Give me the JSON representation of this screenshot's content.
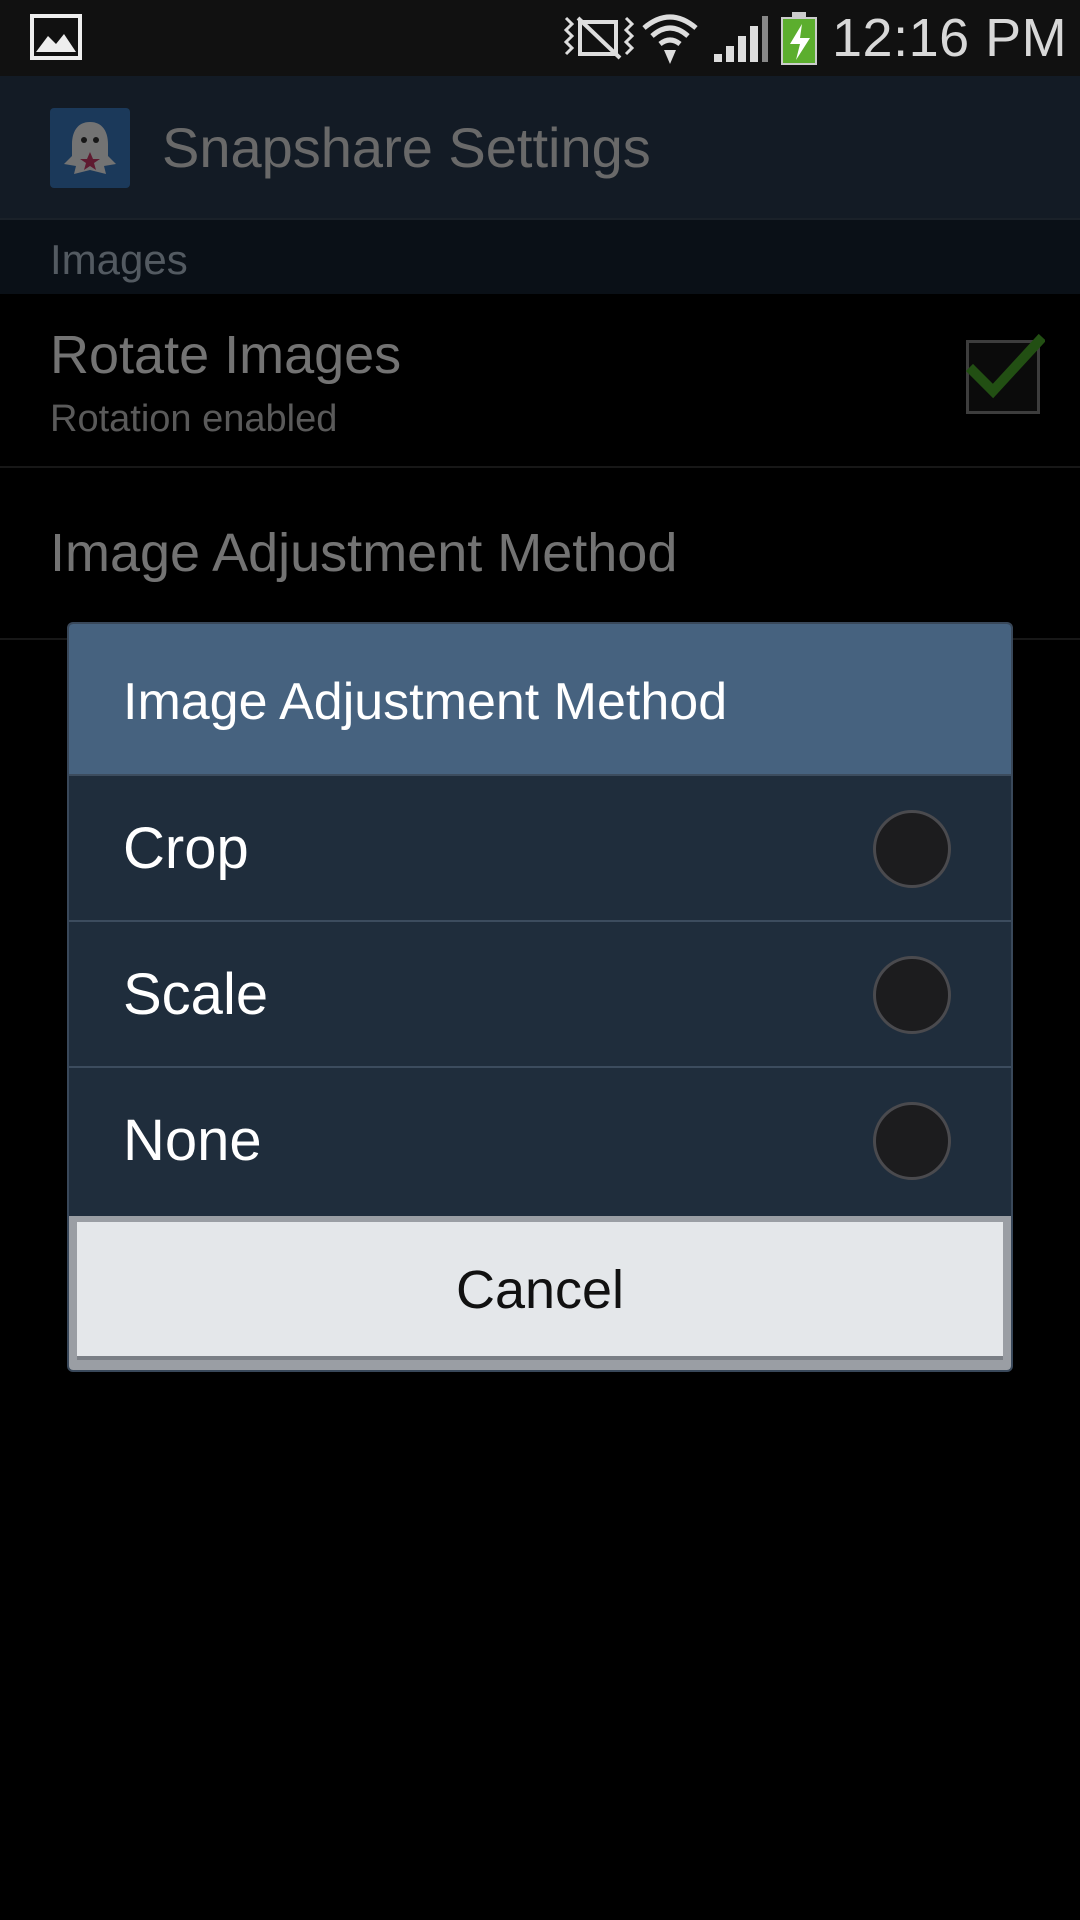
{
  "status_bar": {
    "time": "12:16 PM",
    "icons": [
      "gallery-icon",
      "nfc-icon",
      "wifi-icon",
      "signal-icon",
      "battery-charging-icon"
    ]
  },
  "action_bar": {
    "title": "Snapshare Settings",
    "app_icon": "snapshare-ghost-icon"
  },
  "section": {
    "header": "Images"
  },
  "preferences": {
    "rotate": {
      "title": "Rotate Images",
      "summary": "Rotation enabled",
      "checked": true
    },
    "adjustment": {
      "title": "Image Adjustment Method"
    }
  },
  "dialog": {
    "title": "Image Adjustment Method",
    "options": [
      {
        "label": "Crop",
        "selected": false
      },
      {
        "label": "Scale",
        "selected": false
      },
      {
        "label": "None",
        "selected": false
      }
    ],
    "cancel_label": "Cancel"
  },
  "colors": {
    "dialog_title_bg": "#46627f",
    "dialog_body_bg": "#1f2d3c",
    "checkmark": "#4caf2a"
  }
}
